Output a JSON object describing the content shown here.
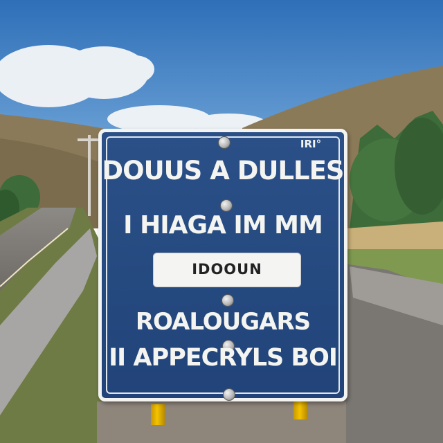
{
  "sign": {
    "corner_tag": "IRI°",
    "line1": "DOUUS A DULLES",
    "line2": "I HIAGA IM  MM",
    "plate": "IDOOUN",
    "line3": "ROALOUGARS",
    "line4": "II APPECRYLS BOI"
  },
  "colors": {
    "sign_blue": "#254a80",
    "sign_border": "#f3f4f2",
    "sky": "#4a86c8",
    "post_yellow": "#f3c300"
  }
}
